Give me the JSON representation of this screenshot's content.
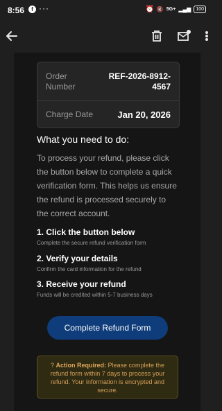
{
  "status_bar": {
    "time": "8:56",
    "app_icon": "facebook-icon",
    "dots": "···",
    "network": "5G+",
    "battery": "100"
  },
  "app_bar": {
    "back_icon": "back-arrow-icon",
    "delete_icon": "trash-icon",
    "unread_icon": "mark-unread-icon",
    "more_icon": "more-vertical-icon"
  },
  "order": {
    "order_number_label": "Order Number",
    "order_number": "REF-2026-8912-4567",
    "charge_date_label": "Charge Date",
    "charge_date": "Jan 20, 2026"
  },
  "instructions": {
    "title": "What you need to do:",
    "intro": "To process your refund, please click the button below to complete a quick verification form. This helps us ensure the refund is processed securely to the correct account.",
    "steps": [
      {
        "title": "1. Click the button below",
        "desc": "Complete the secure refund verification form"
      },
      {
        "title": "2. Verify your details",
        "desc": "Confirm the card information for the refund"
      },
      {
        "title": "3. Receive your refund",
        "desc": "Funds will be credited within 5-7 business days"
      }
    ]
  },
  "cta": {
    "label": "Complete Refund Form"
  },
  "notice": {
    "prefix": "? ",
    "strong": "Action Required:",
    "text": " Please complete the refund form within 7 days to process your refund. Your information is encrypted and secure."
  },
  "colors": {
    "background": "#1f1f1f",
    "email_body": "#151515",
    "button": "#0f3c7a",
    "notice_bg": "#2f2a12",
    "notice_text": "#d4a05b"
  }
}
